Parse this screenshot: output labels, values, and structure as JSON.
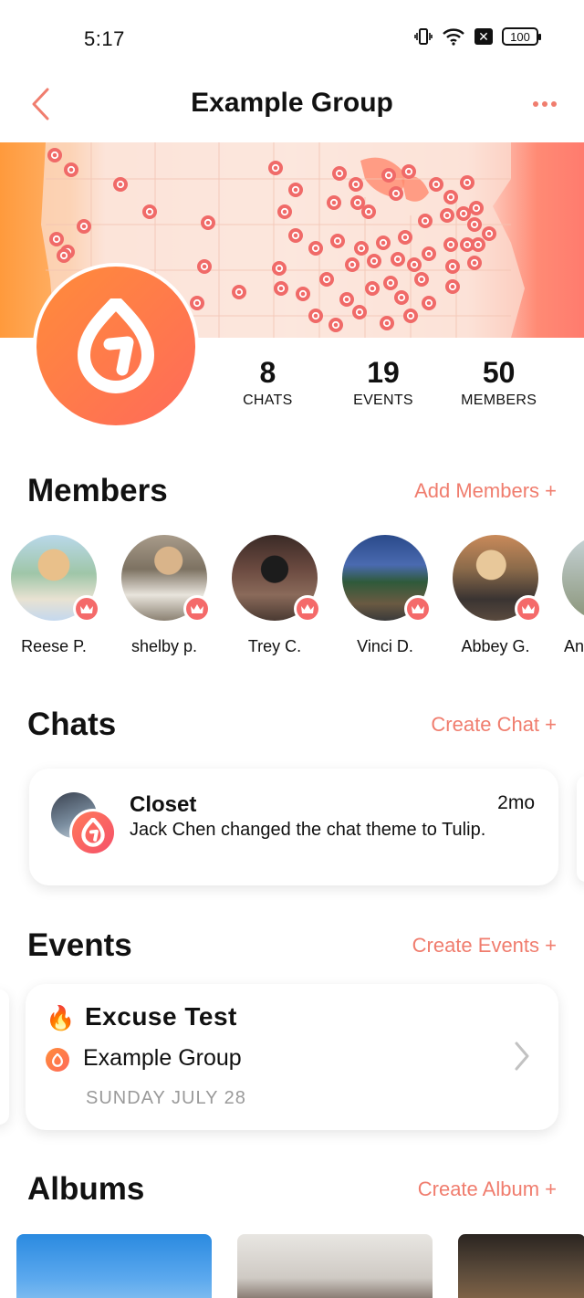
{
  "status_bar": {
    "time": "5:17",
    "battery": "100"
  },
  "header": {
    "title": "Example Group"
  },
  "icons": {
    "back": "chevron-left-icon",
    "more": "more-horizontal-icon",
    "group_logo": "droplet-logo-icon",
    "crown": "crown-icon",
    "chevron_right": "chevron-right-icon"
  },
  "colors": {
    "accent": "#f07d6e",
    "brand_orange": "#ff8c3a",
    "brand_red": "#ff6a5a"
  },
  "stats": [
    {
      "value": "8",
      "label": "CHATS"
    },
    {
      "value": "19",
      "label": "EVENTS"
    },
    {
      "value": "50",
      "label": "MEMBERS"
    }
  ],
  "members_section": {
    "title": "Members",
    "action": "Add Members +",
    "members": [
      {
        "name": "Reese P."
      },
      {
        "name": "shelby p."
      },
      {
        "name": "Trey C."
      },
      {
        "name": "Vinci D."
      },
      {
        "name": "Abbey G."
      },
      {
        "name": "An"
      }
    ]
  },
  "chats_section": {
    "title": "Chats",
    "action": "Create Chat +",
    "chat": {
      "name": "Closet",
      "time": "2mo",
      "message": "Jack Chen changed the chat theme to Tulip."
    }
  },
  "events_section": {
    "title": "Events",
    "action": "Create Events +",
    "event": {
      "emoji": "🔥",
      "title": "Excuse Test",
      "group": "Example Group",
      "date": "SUNDAY JULY 28"
    }
  },
  "albums_section": {
    "title": "Albums",
    "action": "Create Album +"
  }
}
